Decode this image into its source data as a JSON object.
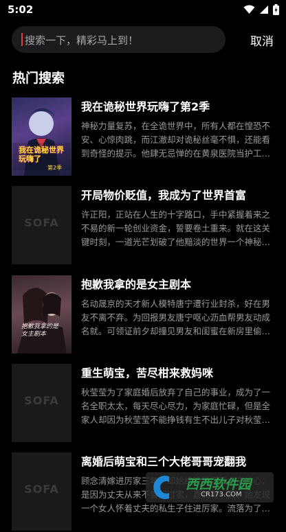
{
  "status_bar": {
    "time": "5:02"
  },
  "search": {
    "placeholder": "搜索一下，精彩马上到！",
    "cancel_label": "取消"
  },
  "section": {
    "title": "热门搜索"
  },
  "books": [
    {
      "title": "我在诡秘世界玩嗨了第2季",
      "desc": "神秘力量复苏，在全诡世界中，所有人都在惶恐不安、心惊肉跳，而江澈却对诡秘丝毫不惧，还能看到奇怪的提示。他肆无忌惮的在黄泉医院当护工…",
      "cover": "art"
    },
    {
      "title": "开局物价贬值，我成为了世界首富",
      "desc": "许正阳，正站在人生的十字路口，手中紧握着来之不易的新一轮创业资金，誓要卷土重来。就在这关键时刻，一道光芒划破了他黯淡的世界一个神秘…",
      "cover": "placeholder"
    },
    {
      "title": "抱歉我拿的是女主剧本",
      "desc": "名动晟京的天才新人模特唐宁遭行业封杀，好在男友不离不弃。为回报男友唐宁呕心沥血帮男友动成名就。可领证前夕却撞见男友和闺蜜在新房里偷…",
      "cover": "art"
    },
    {
      "title": "重生萌宝，苦尽柑来救妈咪",
      "desc": "秋莹莹为了家庭婚后放弃了自己的事业，成为了一名全职太太，每天尽心尽力，为家庭忙碌，但是全家人却因为秋莹莹不能挣钱有生不出儿子对秋莹…",
      "cover": "placeholder"
    },
    {
      "title": "离婚后萌宝和三个大佬哥哥宠翻我",
      "desc": "顾念清嫁进厉家三年，却始终没能得到丈夫的心，是因为丈夫从来不曾回过家，直到有一天，她发现一个女人怀着丈夫的私生子住进厉家。流落为了救…",
      "cover": "placeholder"
    }
  ],
  "cover_placeholder_text": "SOFA",
  "cover_art": [
    {
      "text": "我在诡秘世界玩嗨了",
      "sub": "第2季"
    },
    {
      "text": "抱歉我拿的是女主剧本"
    }
  ],
  "watermark": {
    "text": "西西软件园",
    "site": "CR173.COM"
  },
  "colors": {
    "background": "#000000",
    "search_bg": "#1c1c1e",
    "cursor": "#e63a3a",
    "desc": "#9a9a9a"
  }
}
